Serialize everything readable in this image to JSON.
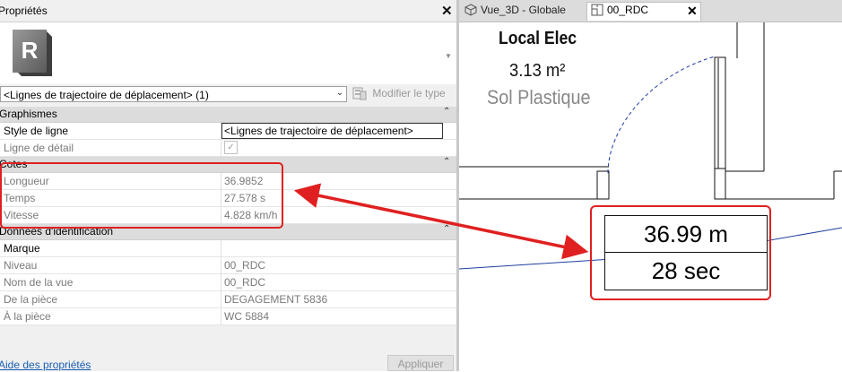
{
  "panel": {
    "title": "Propriétés",
    "close_glyph": "✕",
    "type_thumbnail_letter": "R",
    "type_selector": "<Lignes de trajectoire de déplacement> (1)",
    "edit_type_label": "Modifier le type",
    "help_link": "Aide des propriétés",
    "apply_label": "Appliquer",
    "groups": [
      {
        "label": "Graphismes",
        "rows": [
          {
            "key": "Style de ligne",
            "value": "<Lignes de trajectoire de déplacement>"
          },
          {
            "key": "Ligne de détail",
            "value": "✓"
          }
        ]
      },
      {
        "label": "Cotes",
        "rows": [
          {
            "key": "Longueur",
            "value": "36.9852"
          },
          {
            "key": "Temps",
            "value": "27.578 s"
          },
          {
            "key": "Vitesse",
            "value": "4.828 km/h"
          }
        ]
      },
      {
        "label": "Données d'identification",
        "rows": [
          {
            "key": "Marque",
            "value": ""
          },
          {
            "key": "Niveau",
            "value": "00_RDC"
          },
          {
            "key": "Nom de la vue",
            "value": "00_RDC"
          },
          {
            "key": "De la pièce",
            "value": "DEGAGEMENT 5836"
          },
          {
            "key": "À la pièce",
            "value": "WC 5884"
          }
        ]
      }
    ]
  },
  "tabs": [
    {
      "label": "Vue_3D - Globale",
      "icon": "3d-view-icon",
      "active": false
    },
    {
      "label": "00_RDC",
      "icon": "floor-plan-icon",
      "active": true
    }
  ],
  "view": {
    "room_name": "Local Elec",
    "room_area": "3.13 m²",
    "room_floor": "Sol Plastique",
    "tag_length": "36.99 m",
    "tag_time": "28 sec"
  },
  "colors": {
    "annotation_red": "#e02020",
    "path_line": "#1f3fa0",
    "link": "#1a5fb4"
  }
}
